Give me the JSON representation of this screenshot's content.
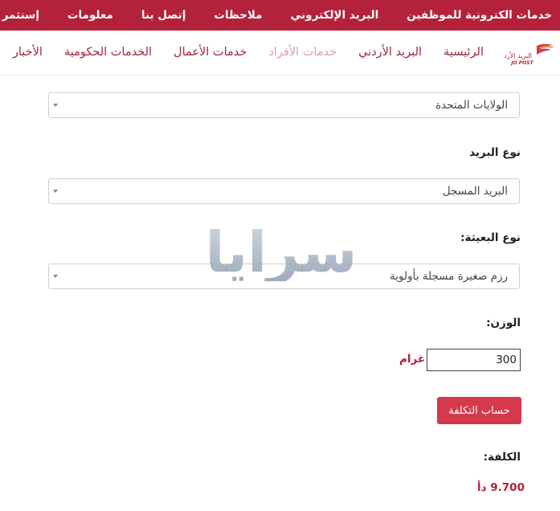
{
  "top_menu": [
    "خدمات الكترونية للموظفين",
    "البريد الإلكتروني",
    "ملاحظات",
    "إتصل بنا",
    "معلومات",
    "إستثمر في الأردن"
  ],
  "main_nav": {
    "items": [
      "الرئيسية",
      "البريد الأردني",
      "خدمات الأفراد",
      "خدمات الأعمال",
      "الخدمات الحكومية",
      "الأخبار"
    ],
    "active_index": 2
  },
  "logo": {
    "text_ar": "البريد الأردني",
    "text_en": "JO POST"
  },
  "form": {
    "country_value": "الولايات المتحدة",
    "mail_type_label": "نوع البريد",
    "mail_type_value": "البريد المسجل",
    "package_type_label": "نوع البعيثة:",
    "package_type_value": "رزم صغيرة مسجلة بأولوية",
    "weight_label": "الوزن:",
    "weight_value": "300",
    "weight_unit": "غرام",
    "calculate_label": "حساب التكلفة"
  },
  "result": {
    "cost_label": "الكلفة:",
    "cost_value": "9.700 دأ"
  },
  "watermark_text": "سرايا",
  "colors": {
    "brand": "#b3223a",
    "button": "#d6384c",
    "active_nav": "#d9a0a8"
  }
}
